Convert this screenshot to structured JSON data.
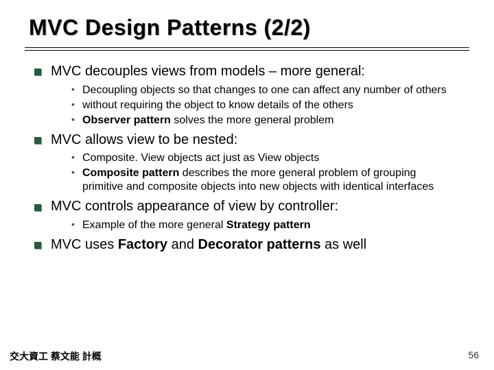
{
  "title": "MVC  Design Patterns  (2/2)",
  "points": [
    {
      "text": "MVC decouples views from models – more general:",
      "sub": [
        {
          "html": "Decoupling objects so that changes to one can affect any number of others"
        },
        {
          "html": "without requiring the object to know details of the others"
        },
        {
          "html": "<b>Observer pattern</b> solves the more general problem"
        }
      ]
    },
    {
      "text": "MVC allows view to be nested:",
      "sub": [
        {
          "html": "Composite. View objects act just as View objects"
        },
        {
          "html": "<b>Composite pattern</b> describes the more general problem of grouping primitive and composite objects into new objects with identical interfaces"
        }
      ]
    },
    {
      "text": "MVC controls appearance of view by controller:",
      "sub": [
        {
          "html": "Example of the more general <b>Strategy pattern</b>"
        }
      ]
    },
    {
      "html": "MVC uses <b>Factory</b> and <b>Decorator patterns</b> as well",
      "sub": []
    }
  ],
  "footer_left": "交大資工 蔡文能 計概",
  "page_number": "56"
}
